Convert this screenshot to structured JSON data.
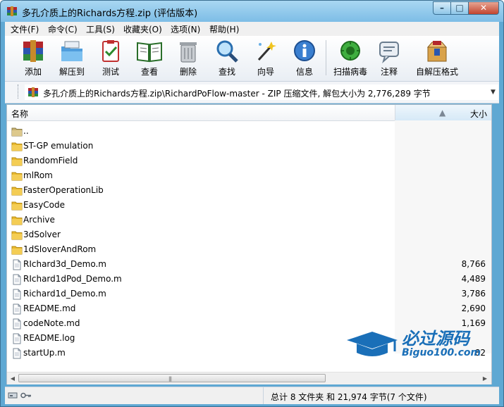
{
  "window": {
    "title": "多孔介质上的Richards方程.zip (评估版本)",
    "controls": {
      "minimize": "–",
      "maximize": "□",
      "close": "✕"
    }
  },
  "menu": [
    {
      "label": "文件(F)"
    },
    {
      "label": "命令(C)"
    },
    {
      "label": "工具(S)"
    },
    {
      "label": "收藏夹(O)"
    },
    {
      "label": "选项(N)"
    },
    {
      "label": "帮助(H)"
    }
  ],
  "toolbar": [
    {
      "label": "添加",
      "icon": "add-archive-icon"
    },
    {
      "label": "解压到",
      "icon": "extract-to-icon"
    },
    {
      "label": "测试",
      "icon": "test-icon"
    },
    {
      "label": "查看",
      "icon": "view-icon"
    },
    {
      "label": "删除",
      "icon": "delete-icon"
    },
    {
      "label": "查找",
      "icon": "find-icon"
    },
    {
      "label": "向导",
      "icon": "wizard-icon"
    },
    {
      "label": "信息",
      "icon": "info-icon"
    },
    {
      "label": "扫描病毒",
      "icon": "virus-scan-icon"
    },
    {
      "label": "注释",
      "icon": "comment-icon"
    },
    {
      "label": "自解压格式",
      "icon": "sfx-icon"
    }
  ],
  "address": {
    "path": "多孔介质上的Richards方程.zip\\RichardPoFlow-master - ZIP 压缩文件, 解包大小为 2,776,289 字节"
  },
  "columns": {
    "name": "名称",
    "size": "大小"
  },
  "files": [
    {
      "name": "..",
      "size": "",
      "type": "parent"
    },
    {
      "name": "ST-GP emulation",
      "size": "",
      "type": "folder"
    },
    {
      "name": "RandomField",
      "size": "",
      "type": "folder"
    },
    {
      "name": "mlRom",
      "size": "",
      "type": "folder"
    },
    {
      "name": "FasterOperationLib",
      "size": "",
      "type": "folder"
    },
    {
      "name": "EasyCode",
      "size": "",
      "type": "folder"
    },
    {
      "name": "Archive",
      "size": "",
      "type": "folder"
    },
    {
      "name": "3dSolver",
      "size": "",
      "type": "folder"
    },
    {
      "name": "1dSloverAndRom",
      "size": "",
      "type": "folder"
    },
    {
      "name": "RIchard3d_Demo.m",
      "size": "8,766",
      "type": "file"
    },
    {
      "name": "RIchard1dPod_Demo.m",
      "size": "4,489",
      "type": "file"
    },
    {
      "name": "Richard1d_Demo.m",
      "size": "3,786",
      "type": "file"
    },
    {
      "name": "README.md",
      "size": "2,690",
      "type": "file"
    },
    {
      "name": "codeNote.md",
      "size": "1,169",
      "type": "file"
    },
    {
      "name": "README.log",
      "size": "",
      "type": "file"
    },
    {
      "name": "startUp.m",
      "size": "82",
      "type": "file"
    }
  ],
  "status": {
    "summary": "总计 8 文件夹 和 21,974 字节(7 个文件)"
  },
  "watermark": {
    "brand": "必过源码",
    "site": "Biguo100.com"
  },
  "colors": {
    "titlebar": "#7dbde6",
    "folder": "#e9b92e",
    "watermark": "#1a6fb8"
  }
}
